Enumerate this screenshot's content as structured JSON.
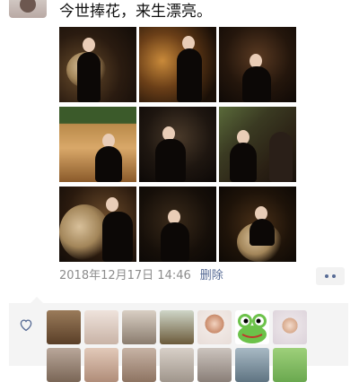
{
  "post": {
    "text": "今世捧花，来生漂亮。",
    "timestamp": "2018年12月17日 14:46",
    "delete_label": "删除"
  },
  "icons": {
    "more": "more-dots-icon",
    "like": "heart-outline-icon"
  },
  "colors": {
    "link_blue": "#576b95",
    "meta_gray": "#8c8c8c",
    "like_panel_bg": "#f4f4f4"
  }
}
